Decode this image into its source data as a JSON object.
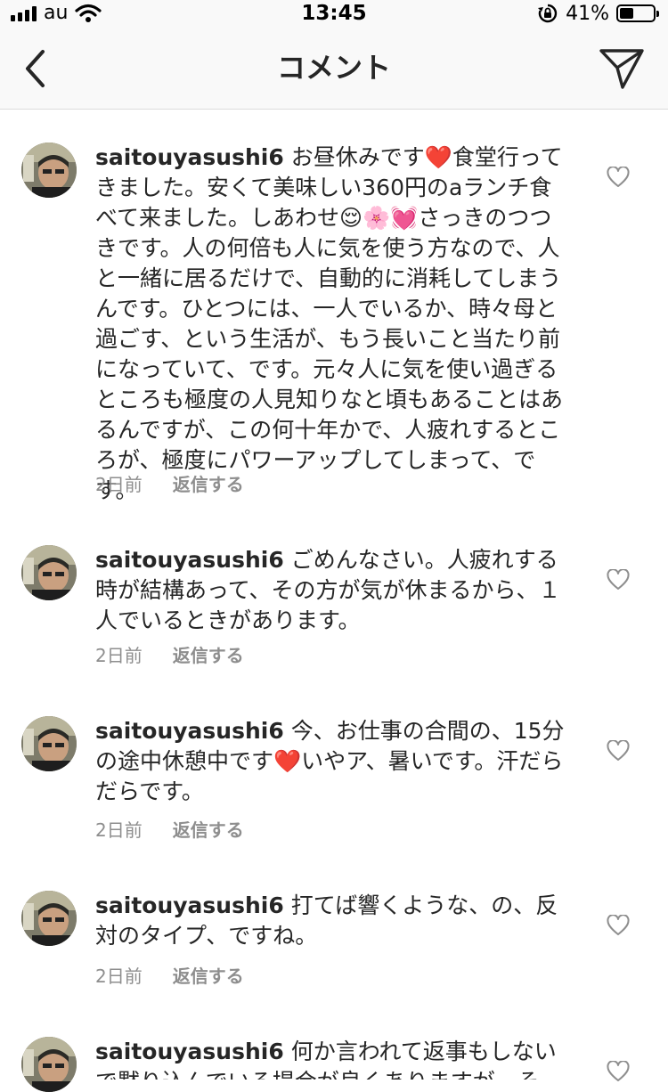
{
  "status_bar": {
    "carrier": "au",
    "time": "13:45",
    "battery": "41%",
    "battery_level": 0.41
  },
  "header": {
    "title": "コメント"
  },
  "comments": [
    {
      "username": "saitouyasushi6",
      "text": "お昼休みです❤️食堂行ってきました。安くて美味しい360円のaランチ食べて来ました。しあわせ😌🌸💓さっきのつつきです。人の何倍も人に気を使う方なので、人と一緒に居るだけで、自動的に消耗してしまうんです。ひとつには、一人でいるか、時々母と過ごす、という生活が、もう長いこと当たり前になっていて、です。元々人に気を使い過ぎるところも極度の人見知りなと頃もあることはあるんですが、この何十年かで、人疲れするところが、極度にパワーアップしてしまって、です。",
      "time": "2日前",
      "reply": "返信する"
    },
    {
      "username": "saitouyasushi6",
      "text": "ごめんなさい。人疲れする時が結構あって、その方が気が休まるから、１人でいるときがあります。",
      "time": "2日前",
      "reply": "返信する"
    },
    {
      "username": "saitouyasushi6",
      "text": "今、お仕事の合間の、15分の途中休憩中です❤️いやア、暑いです。汗だらだらです。",
      "time": "2日前",
      "reply": "返信する"
    },
    {
      "username": "saitouyasushi6",
      "text": "打てば響くような、の、反対のタイプ、ですね。",
      "time": "2日前",
      "reply": "返信する"
    },
    {
      "username": "saitouyasushi6",
      "text": "何か言われて返事もしないで黙り込んでいる場合が良くありますが、そ",
      "time": "",
      "reply": ""
    }
  ],
  "colors": {
    "text": "#262626",
    "secondary": "#8e8e8e",
    "divider": "#dbdbdb",
    "header_bg": "#f9f9f9"
  }
}
